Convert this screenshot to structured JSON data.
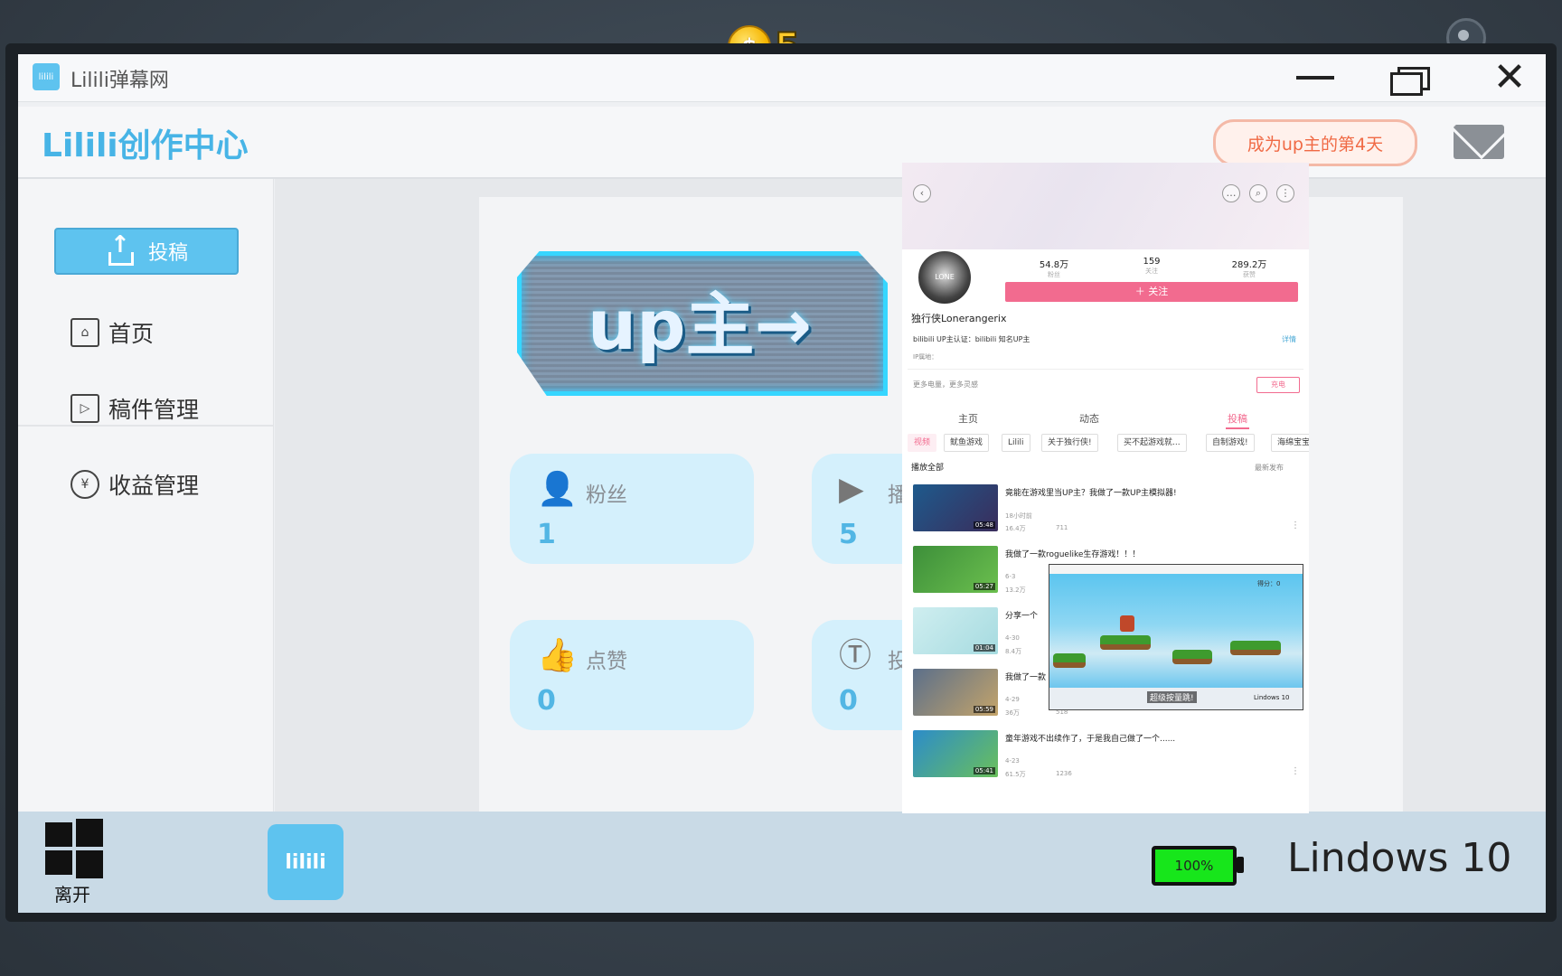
{
  "hud": {
    "coin_symbol": "$",
    "coins": "5"
  },
  "window": {
    "title": "Lilili弹幕网",
    "app_icon_text": "lilili"
  },
  "header": {
    "brand": "Lilili创作中心",
    "days_badge": "成为up主的第4天"
  },
  "sidebar": {
    "upload_label": "投稿",
    "items": [
      {
        "label": "首页",
        "icon": "home-icon"
      },
      {
        "label": "稿件管理",
        "icon": "video-file-icon"
      },
      {
        "label": "收益管理",
        "icon": "money-bag-icon"
      }
    ]
  },
  "banner": {
    "text": "up主→"
  },
  "stats": [
    {
      "label": "粉丝",
      "value": "1",
      "icon": "user-icon"
    },
    {
      "label": "播",
      "value": "5",
      "icon": "play-icon"
    },
    {
      "label": "点赞",
      "value": "0",
      "icon": "thumbs-up-icon"
    },
    {
      "label": "投",
      "value": "0",
      "icon": "coin-icon"
    }
  ],
  "phone": {
    "avatar_text": "LONE",
    "stats": [
      {
        "value": "54.8万",
        "label": "粉丝"
      },
      {
        "value": "159",
        "label": "关注"
      },
      {
        "value": "289.2万",
        "label": "获赞"
      }
    ],
    "follow_label": "＋ 关注",
    "name": "独行侠Lonerangerix",
    "verify": "bilibili UP主认证：bilibili 知名UP主",
    "detail": "详情",
    "ip": "IP属地：",
    "more": "更多电量，更多灵感",
    "charge": "充电",
    "tabs": [
      "主页",
      "动态",
      "投稿"
    ],
    "chips": [
      "视频",
      "鱿鱼游戏",
      "Lilili",
      "关于独行侠!",
      "买不起游戏就...",
      "自制游戏!",
      "海绵宝宝"
    ],
    "play_all": "播放全部",
    "sort": "最新发布",
    "videos": [
      {
        "title": "竟能在游戏里当UP主？我做了一款UP主模拟器!",
        "date": "18小时前",
        "views": "16.4万",
        "comments": "711",
        "duration": "05:48"
      },
      {
        "title": "我做了一款roguelike生存游戏！！！",
        "date": "6-3",
        "views": "13.2万",
        "comments": "",
        "duration": "05:27"
      },
      {
        "title": "分享一个",
        "date": "4-30",
        "views": "8.4万",
        "comments": "",
        "duration": "01:04"
      },
      {
        "title": "我做了一款",
        "date": "4-29",
        "views": "36万",
        "comments": "518",
        "duration": "05:59"
      },
      {
        "title": "童年游戏不出续作了，于是我自己做了一个......",
        "date": "4-23",
        "views": "61.5万",
        "comments": "1236",
        "duration": "05:41"
      }
    ],
    "minigame": {
      "score": "得分：0",
      "hint": "超级按量跳!",
      "os": "Lindows 10"
    }
  },
  "taskbar": {
    "start_label": "离开",
    "app_label": "lilili",
    "battery": "100%",
    "os_name": "Lindows 10"
  }
}
